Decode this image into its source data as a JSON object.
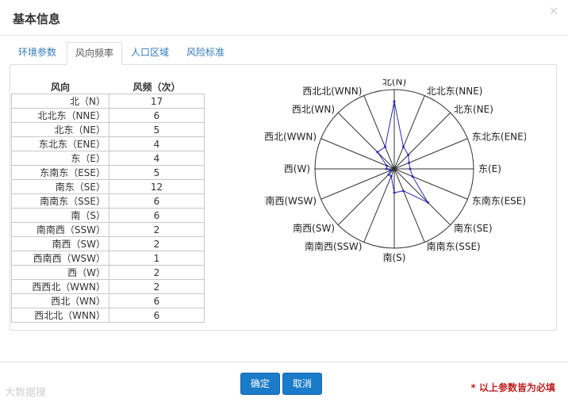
{
  "dialog": {
    "title": "基本信息",
    "close_glyph": "×"
  },
  "tabs": [
    {
      "label": "环境参数",
      "active": false
    },
    {
      "label": "风向频率",
      "active": true
    },
    {
      "label": "人口区域",
      "active": false
    },
    {
      "label": "风险标准",
      "active": false
    }
  ],
  "table": {
    "headers": {
      "direction": "风向",
      "frequency": "风频（次）"
    },
    "rows": [
      {
        "dir": "北（N）",
        "count": 17
      },
      {
        "dir": "北北东（NNE）",
        "count": 6
      },
      {
        "dir": "北东（NE）",
        "count": 5
      },
      {
        "dir": "东北东（ENE）",
        "count": 4
      },
      {
        "dir": "东（E）",
        "count": 4
      },
      {
        "dir": "东南东（ESE）",
        "count": 5
      },
      {
        "dir": "南东（SE）",
        "count": 12
      },
      {
        "dir": "南南东（SSE）",
        "count": 6
      },
      {
        "dir": "南（S）",
        "count": 6
      },
      {
        "dir": "南南西（SSW）",
        "count": 2
      },
      {
        "dir": "南西（SW）",
        "count": 2
      },
      {
        "dir": "西南西（WSW）",
        "count": 1
      },
      {
        "dir": "西（W）",
        "count": 2
      },
      {
        "dir": "西西北（WWN）",
        "count": 2
      },
      {
        "dir": "西北（WN）",
        "count": 6
      },
      {
        "dir": "西北北（WNN）",
        "count": 6
      }
    ]
  },
  "chart_data": {
    "type": "radar",
    "categories": [
      "北(N)",
      "北北东(NNE)",
      "北东(NE)",
      "东北东(ENE)",
      "东(E)",
      "东南东(ESE)",
      "南东(SE)",
      "南南东(SSE)",
      "南(S)",
      "南南西(SSW)",
      "南西(SW)",
      "西南西(WSW)",
      "西(W)",
      "西西北(WWN)",
      "西北(WN)",
      "西北北(WNN)"
    ],
    "values": [
      17,
      6,
      5,
      4,
      4,
      5,
      12,
      6,
      6,
      2,
      2,
      1,
      2,
      2,
      6,
      6
    ],
    "max": 20,
    "line_color": "#2b2bbf",
    "grid": true
  },
  "footer": {
    "confirm_label": "确定",
    "cancel_label": "取消",
    "required_note": "* 以上参数皆为必填",
    "watermark": "大数据搜"
  }
}
